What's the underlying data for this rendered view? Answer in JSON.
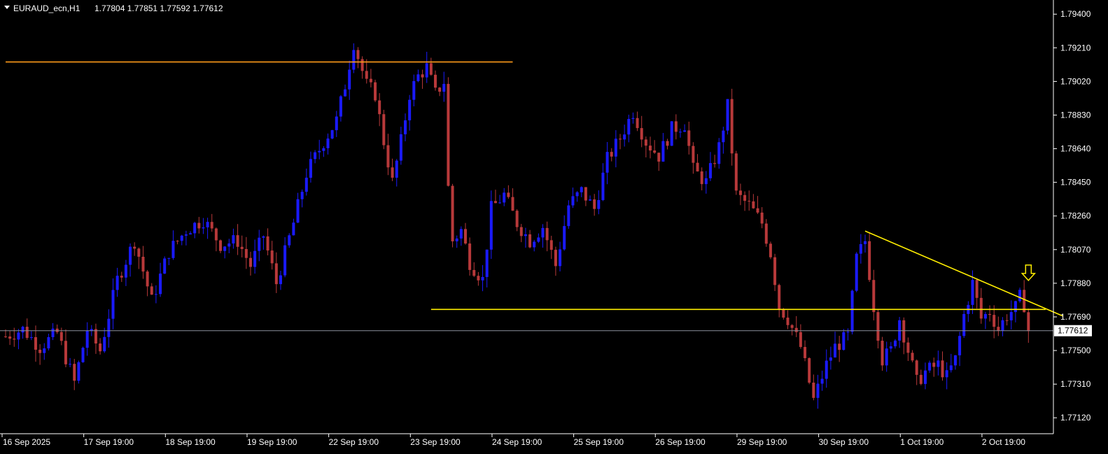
{
  "header": {
    "symbol": "EURAUD_ecn,H1",
    "ohlc": "1.77804 1.77851 1.77592 1.77612"
  },
  "colors": {
    "background": "#000000",
    "bull_candle": "#1a1aff",
    "bear_candle": "#b8393a",
    "axis": "#ffffff",
    "level_orange": "#ff9c1a",
    "trendline_yellow": "#ffee00",
    "current_price_line": "#8a8f9c",
    "arrow": "#ffee00"
  },
  "icons": {
    "menu": "triangle-down-icon",
    "signal": "down-arrow-icon"
  },
  "chart_data": {
    "type": "candlestick",
    "symbol": "EURAUD_ecn",
    "timeframe": "H1",
    "current_price": "1.77612",
    "ylim": [
      1.7703,
      1.7948
    ],
    "y_ticks": [
      "1.79400",
      "1.79210",
      "1.79020",
      "1.78830",
      "1.78640",
      "1.78450",
      "1.78260",
      "1.78070",
      "1.77880",
      "1.77690",
      "1.77500",
      "1.77310",
      "1.77120"
    ],
    "x_ticks": [
      "16 Sep 2025",
      "17 Sep 19:00",
      "18 Sep 19:00",
      "19 Sep 19:00",
      "22 Sep 19:00",
      "23 Sep 19:00",
      "24 Sep 19:00",
      "25 Sep 19:00",
      "26 Sep 19:00",
      "29 Sep 19:00",
      "30 Sep 19:00",
      "1 Oct 19:00",
      "2 Oct 19:00"
    ],
    "x_tick_positions": [
      0,
      19,
      38,
      57,
      76,
      95,
      114,
      133,
      152,
      171,
      190,
      209,
      228
    ],
    "bars_total": 242,
    "close_path": [
      [
        0,
        1.7758
      ],
      [
        4,
        1.7762
      ],
      [
        8,
        1.7752
      ],
      [
        12,
        1.776
      ],
      [
        16,
        1.7732
      ],
      [
        19,
        1.7762
      ],
      [
        22,
        1.775
      ],
      [
        26,
        1.779
      ],
      [
        30,
        1.7812
      ],
      [
        34,
        1.7778
      ],
      [
        38,
        1.7806
      ],
      [
        42,
        1.7818
      ],
      [
        46,
        1.7824
      ],
      [
        50,
        1.781
      ],
      [
        54,
        1.7812
      ],
      [
        57,
        1.7798
      ],
      [
        60,
        1.7815
      ],
      [
        63,
        1.7788
      ],
      [
        67,
        1.7822
      ],
      [
        70,
        1.785
      ],
      [
        74,
        1.7868
      ],
      [
        77,
        1.788
      ],
      [
        79,
        1.79
      ],
      [
        81,
        1.7924
      ],
      [
        84,
        1.79
      ],
      [
        86,
        1.7895
      ],
      [
        88,
        1.7868
      ],
      [
        90,
        1.7845
      ],
      [
        92,
        1.7868
      ],
      [
        94,
        1.7895
      ],
      [
        96,
        1.7905
      ],
      [
        98,
        1.791
      ],
      [
        100,
        1.7895
      ],
      [
        102,
        1.7902
      ],
      [
        103,
        1.7842
      ],
      [
        104,
        1.7812
      ],
      [
        106,
        1.7818
      ],
      [
        108,
        1.78
      ],
      [
        111,
        1.779
      ],
      [
        113,
        1.783
      ],
      [
        116,
        1.7838
      ],
      [
        119,
        1.7822
      ],
      [
        122,
        1.7812
      ],
      [
        125,
        1.782
      ],
      [
        128,
        1.7798
      ],
      [
        131,
        1.7832
      ],
      [
        134,
        1.784
      ],
      [
        137,
        1.783
      ],
      [
        140,
        1.7858
      ],
      [
        143,
        1.787
      ],
      [
        146,
        1.7885
      ],
      [
        149,
        1.7868
      ],
      [
        152,
        1.786
      ],
      [
        155,
        1.7875
      ],
      [
        158,
        1.7878
      ],
      [
        160,
        1.7852
      ],
      [
        163,
        1.7845
      ],
      [
        166,
        1.7865
      ],
      [
        168,
        1.7888
      ],
      [
        170,
        1.7838
      ],
      [
        173,
        1.7832
      ],
      [
        176,
        1.7822
      ],
      [
        178,
        1.7805
      ],
      [
        180,
        1.7775
      ],
      [
        182,
        1.7768
      ],
      [
        185,
        1.7752
      ],
      [
        188,
        1.7722
      ],
      [
        191,
        1.7742
      ],
      [
        193,
        1.7752
      ],
      [
        196,
        1.7758
      ],
      [
        198,
        1.7802
      ],
      [
        200,
        1.7812
      ],
      [
        202,
        1.7775
      ],
      [
        204,
        1.7745
      ],
      [
        206,
        1.775
      ],
      [
        208,
        1.7768
      ],
      [
        210,
        1.775
      ],
      [
        212,
        1.7732
      ],
      [
        214,
        1.7738
      ],
      [
        217,
        1.7742
      ],
      [
        219,
        1.7735
      ],
      [
        221,
        1.7745
      ],
      [
        223,
        1.777
      ],
      [
        225,
        1.7788
      ],
      [
        227,
        1.7768
      ],
      [
        229,
        1.7772
      ],
      [
        231,
        1.7762
      ],
      [
        233,
        1.777
      ],
      [
        235,
        1.7774
      ],
      [
        236,
        1.778
      ],
      [
        237,
        1.7776
      ],
      [
        238,
        1.7761
      ]
    ],
    "drawings": [
      {
        "kind": "horizontal",
        "name": "resistance-level",
        "color": "orange",
        "x_from": 0,
        "x_to": 118,
        "y": 1.7913
      },
      {
        "kind": "horizontal",
        "name": "support-level",
        "color": "yellow",
        "x_from": 99,
        "x_to": 242,
        "y": 1.77732
      },
      {
        "kind": "trendline",
        "name": "descending-trendline",
        "color": "yellow",
        "x_from": 200,
        "y_from": 1.78175,
        "x_to": 246,
        "y_to": 1.77695
      },
      {
        "kind": "current-price",
        "name": "current-price-line",
        "y": 1.77612
      }
    ],
    "annotations": [
      {
        "kind": "arrow-down",
        "x": 238,
        "y": 1.7788
      }
    ]
  }
}
